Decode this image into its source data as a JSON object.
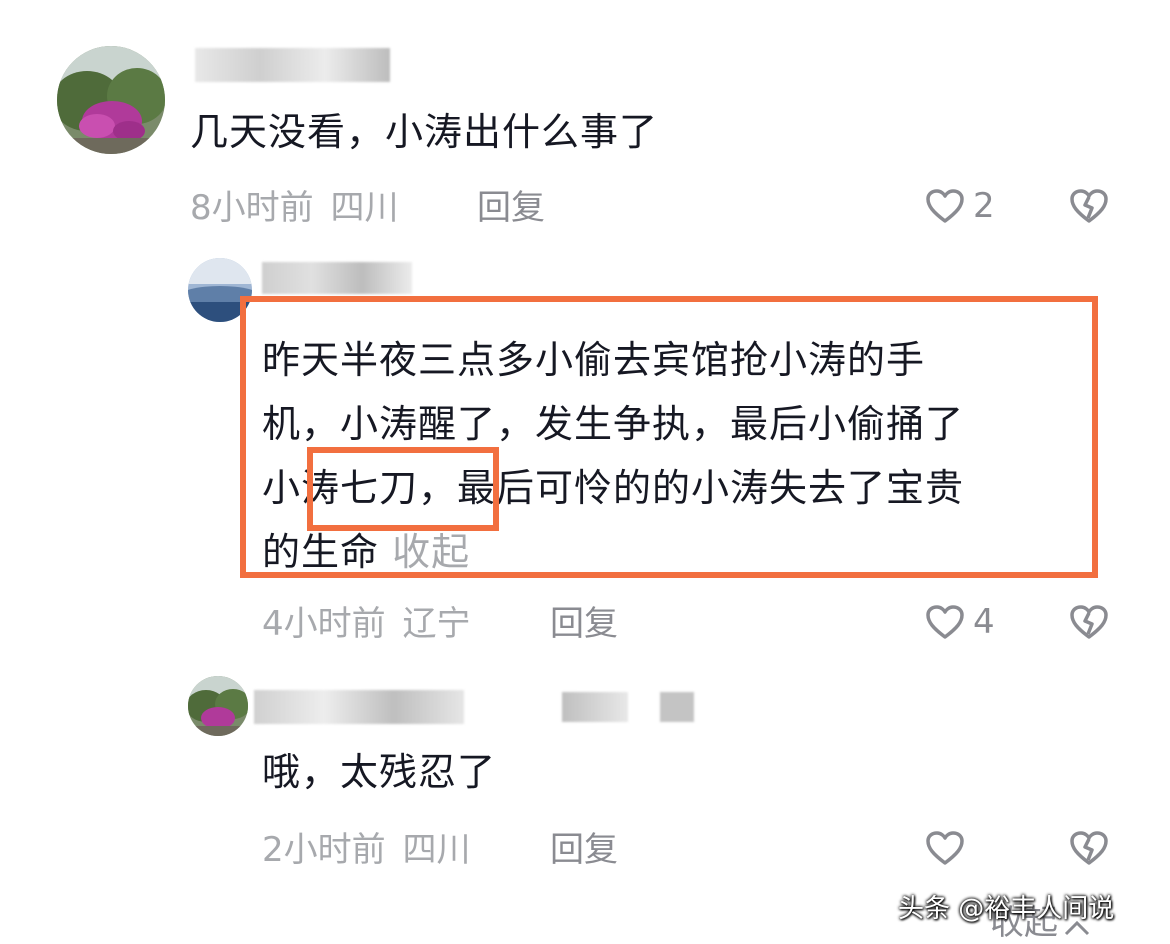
{
  "comments": [
    {
      "text": "几天没看，小涛出什么事了",
      "time": "8小时前",
      "location": "四川",
      "reply_label": "回复",
      "likes": "2"
    },
    {
      "text_lines": [
        "昨天半夜三点多小偷去宾馆抢小涛的手",
        "机，小涛醒了，发生争执，最后小偷捅了",
        "小涛七刀，最后可怜的的小涛失去了宝贵",
        "的生命"
      ],
      "collapse_label": "收起",
      "time": "4小时前",
      "location": "辽宁",
      "reply_label": "回复",
      "likes": "4",
      "highlight_color": "#f26f3f"
    },
    {
      "text": "哦，太残忍了",
      "time": "2小时前",
      "location": "四川",
      "reply_label": "回复"
    }
  ],
  "footer": {
    "collapse_label": "收起",
    "watermark": "头条 @裕丰人间说"
  },
  "icons": {
    "like": "heart-outline-icon",
    "dislike": "broken-heart-icon",
    "collapse": "chevron-up-icon"
  }
}
